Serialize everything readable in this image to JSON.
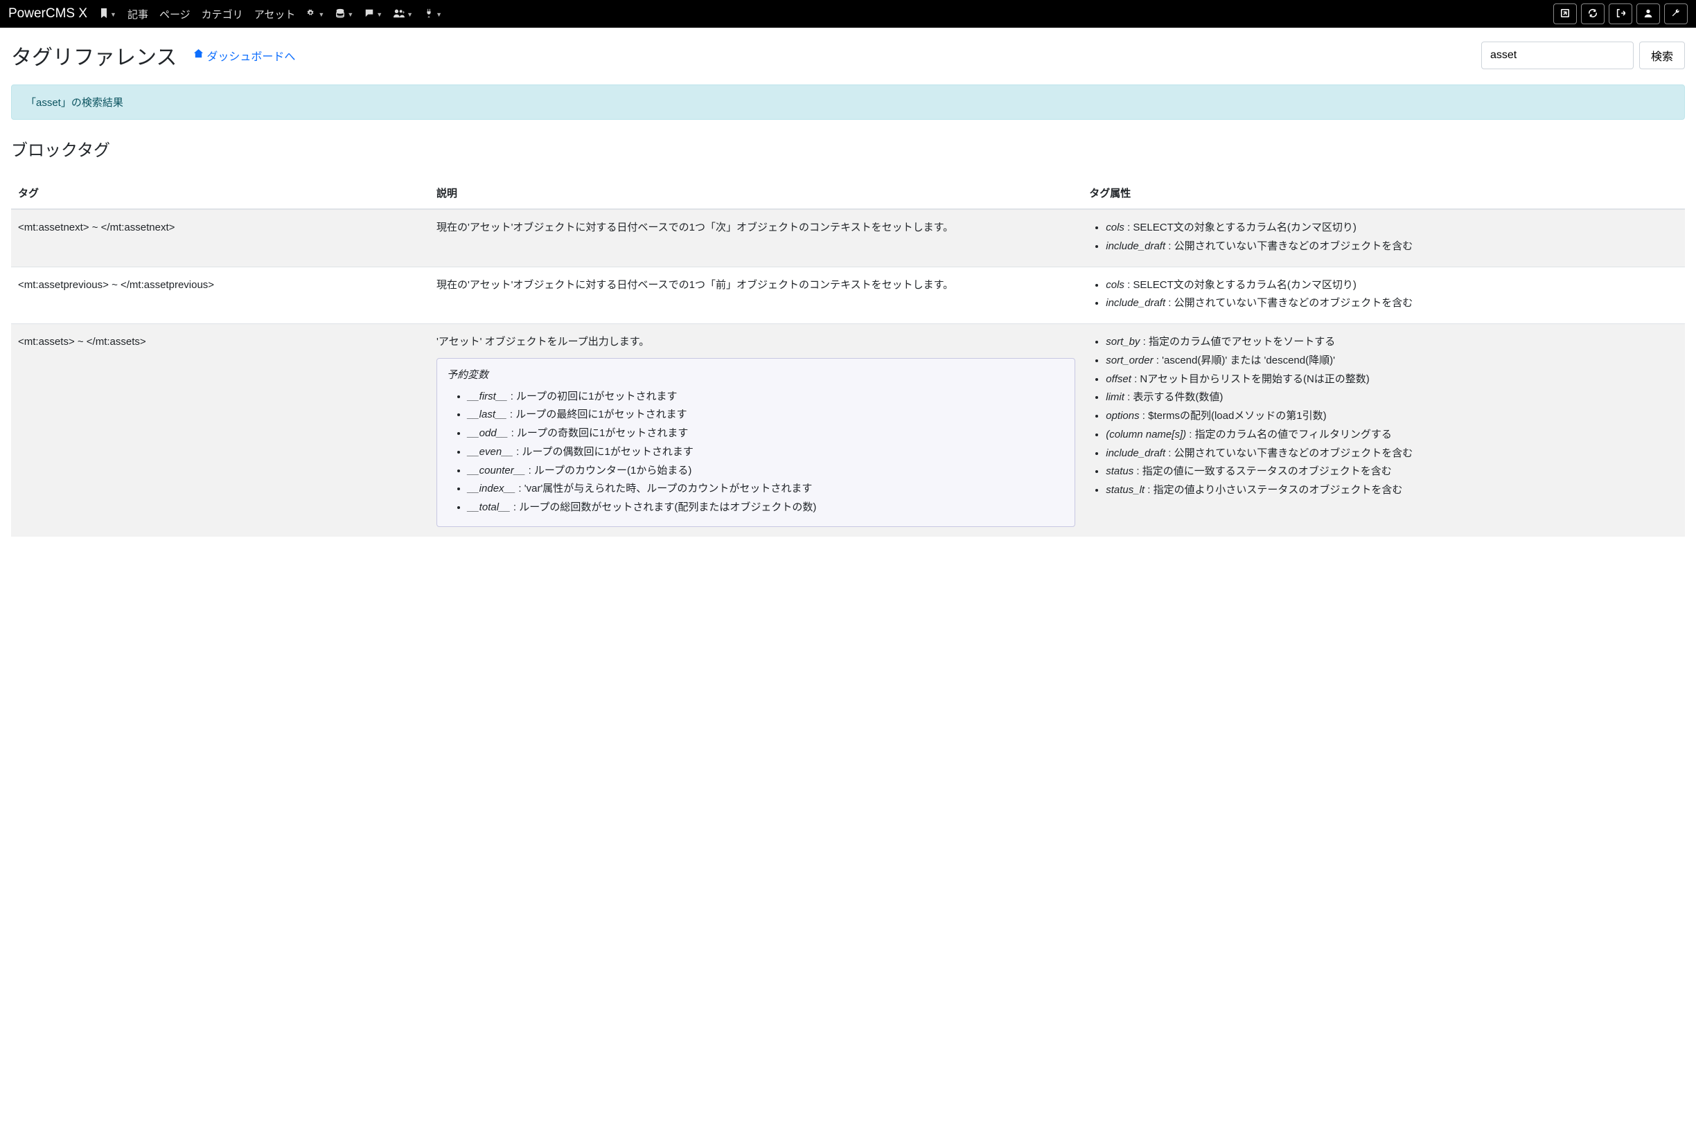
{
  "navbar": {
    "brand": "PowerCMS X",
    "items": [
      {
        "label": "",
        "icon": "bookmark",
        "has_caret": true
      },
      {
        "label": "記事",
        "icon": "",
        "has_caret": false
      },
      {
        "label": "ページ",
        "icon": "",
        "has_caret": false
      },
      {
        "label": "カテゴリ",
        "icon": "",
        "has_caret": false
      },
      {
        "label": "アセット",
        "icon": "",
        "has_caret": false
      },
      {
        "label": "",
        "icon": "gear",
        "has_caret": true
      },
      {
        "label": "",
        "icon": "database",
        "has_caret": true
      },
      {
        "label": "",
        "icon": "comment",
        "has_caret": true
      },
      {
        "label": "",
        "icon": "users",
        "has_caret": true
      },
      {
        "label": "",
        "icon": "plug",
        "has_caret": true
      }
    ],
    "right_icons": [
      "external",
      "refresh",
      "logout",
      "user",
      "wrench"
    ]
  },
  "header": {
    "title": "タグリファレンス",
    "dashboard_link": "ダッシュボードへ",
    "search_value": "asset",
    "search_button": "検索"
  },
  "alert": {
    "text": "「asset」の検索結果"
  },
  "section": {
    "heading": "ブロックタグ"
  },
  "table": {
    "headers": {
      "tag": "タグ",
      "desc": "説明",
      "attr": "タグ属性"
    },
    "rows": [
      {
        "tag": "<mt:assetnext> ~ </mt:assetnext>",
        "desc": "現在の'アセット'オブジェクトに対する日付ベースでの1つ「次」オブジェクトのコンテキストをセットします。",
        "attrs": [
          {
            "name": "cols",
            "text": " : SELECT文の対象とするカラム名(カンマ区切り)"
          },
          {
            "name": "include_draft",
            "text": " : 公開されていない下書きなどのオブジェクトを含む"
          }
        ]
      },
      {
        "tag": "<mt:assetprevious> ~ </mt:assetprevious>",
        "desc": "現在の'アセット'オブジェクトに対する日付ベースでの1つ「前」オブジェクトのコンテキストをセットします。",
        "attrs": [
          {
            "name": "cols",
            "text": " : SELECT文の対象とするカラム名(カンマ区切り)"
          },
          {
            "name": "include_draft",
            "text": " : 公開されていない下書きなどのオブジェクトを含む"
          }
        ]
      },
      {
        "tag": "<mt:assets> ~ </mt:assets>",
        "desc": "'アセット' オブジェクトをループ出力します。",
        "varbox": {
          "title": "予約変数",
          "vars": [
            {
              "name": "__first__",
              "text": " : ループの初回に1がセットされます"
            },
            {
              "name": "__last__",
              "text": " : ループの最終回に1がセットされます"
            },
            {
              "name": "__odd__",
              "text": " : ループの奇数回に1がセットされます"
            },
            {
              "name": "__even__",
              "text": " : ループの偶数回に1がセットされます"
            },
            {
              "name": "__counter__",
              "text": " : ループのカウンター(1から始まる)"
            },
            {
              "name": "__index__",
              "text": " : 'var'属性が与えられた時、ループのカウントがセットされます"
            },
            {
              "name": "__total__",
              "text": " : ループの総回数がセットされます(配列またはオブジェクトの数)"
            }
          ]
        },
        "attrs": [
          {
            "name": "sort_by",
            "text": " : 指定のカラム値でアセットをソートする"
          },
          {
            "name": "sort_order",
            "text": " : 'ascend(昇順)' または 'descend(降順)'"
          },
          {
            "name": "offset",
            "text": " : Nアセット目からリストを開始する(Nは正の整数)"
          },
          {
            "name": "limit",
            "text": " : 表示する件数(数値)"
          },
          {
            "name": "options",
            "text": " : $termsの配列(loadメソッドの第1引数)"
          },
          {
            "name": "(column name[s])",
            "text": " : 指定のカラム名の値でフィルタリングする"
          },
          {
            "name": "include_draft",
            "text": " : 公開されていない下書きなどのオブジェクトを含む"
          },
          {
            "name": "status",
            "text": " : 指定の値に一致するステータスのオブジェクトを含む"
          },
          {
            "name": "status_lt",
            "text": " : 指定の値より小さいステータスのオブジェクトを含む"
          }
        ]
      }
    ]
  },
  "icons": {
    "bookmark": "🔖",
    "gear": "⚙",
    "database": "≣",
    "comment": "💬",
    "users": "👥",
    "plug": "🔌",
    "external": "◳",
    "refresh": "⟳",
    "logout": "⇥",
    "user": "👤",
    "wrench": "🔧",
    "home": "⌂"
  }
}
